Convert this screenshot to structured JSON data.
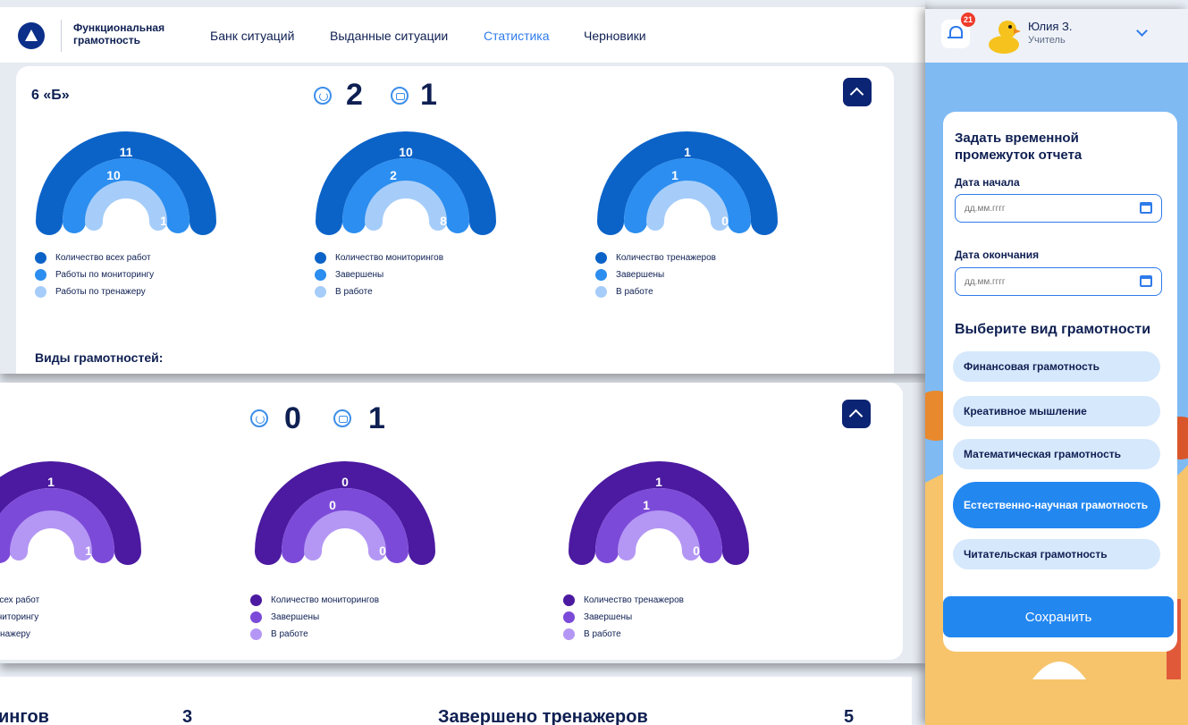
{
  "header": {
    "brand": "Функциональная грамотность",
    "nav": [
      {
        "label": "Банк ситуаций"
      },
      {
        "label": "Выданные ситуации"
      },
      {
        "label": "Статистика"
      },
      {
        "label": "Черновики"
      }
    ]
  },
  "class_card": {
    "title": "6 «Б»",
    "monitorings_count": "2",
    "trainers_count": "1",
    "section_title": "Виды грамотностей:",
    "colors": {
      "outer": "#0b63c8",
      "middle": "#2b8ef0",
      "inner": "#a6cdf9"
    },
    "gauges": [
      {
        "values": {
          "outer": "11",
          "middle": "10",
          "inner": "1"
        },
        "legend": [
          "Количество всех работ",
          "Работы по мониторингу",
          "Работы по тренажеру"
        ]
      },
      {
        "values": {
          "outer": "10",
          "middle": "2",
          "inner": "8"
        },
        "legend": [
          "Количество мониторингов",
          "Завершены",
          "В работе"
        ]
      },
      {
        "values": {
          "outer": "1",
          "middle": "1",
          "inner": "0"
        },
        "legend": [
          "Количество тренажеров",
          "Завершены",
          "В работе"
        ]
      }
    ]
  },
  "literacy_card": {
    "monitorings_count": "0",
    "trainers_count": "1",
    "colors": {
      "outer": "#4b1aa0",
      "middle": "#7c4ad8",
      "inner": "#b497f4"
    },
    "gauges": [
      {
        "values": {
          "outer": "1",
          "middle": "",
          "inner": "1"
        },
        "legend": [
          "тво всех работ",
          "о мониторингу",
          "о тренажеру"
        ]
      },
      {
        "values": {
          "outer": "0",
          "middle": "0",
          "inner": "0"
        },
        "legend": [
          "Количество мониторингов",
          "Завершены",
          "В работе"
        ]
      },
      {
        "values": {
          "outer": "1",
          "middle": "1",
          "inner": "0"
        },
        "legend": [
          "Количество тренажеров",
          "Завершены",
          "В работе"
        ]
      }
    ]
  },
  "bottom": {
    "left_label": "ингов",
    "left_value": "3",
    "right_label": "Завершено тренажеров",
    "right_value": "5"
  },
  "sidebar": {
    "notifications": "21",
    "user_name": "Юлия З.",
    "user_role": "Учитель",
    "filter_title": "Задать временной промежуток отчета",
    "start_label": "Дата начала",
    "start_placeholder": "дд.мм.гггг",
    "end_label": "Дата окончания",
    "end_placeholder": "дд.мм.гггг",
    "literacy_title": "Выберите вид грамотности",
    "literacy_options": [
      {
        "label": "Финансовая грамотность",
        "selected": false
      },
      {
        "label": "Креативное мышление",
        "selected": false
      },
      {
        "label": "Математическая грамотность",
        "selected": false
      },
      {
        "label": "Естественно-научная грамотность",
        "selected": true
      },
      {
        "label": "Читательская грамотность",
        "selected": false
      }
    ],
    "save_label": "Сохранить",
    "accent": "#2387f0"
  }
}
